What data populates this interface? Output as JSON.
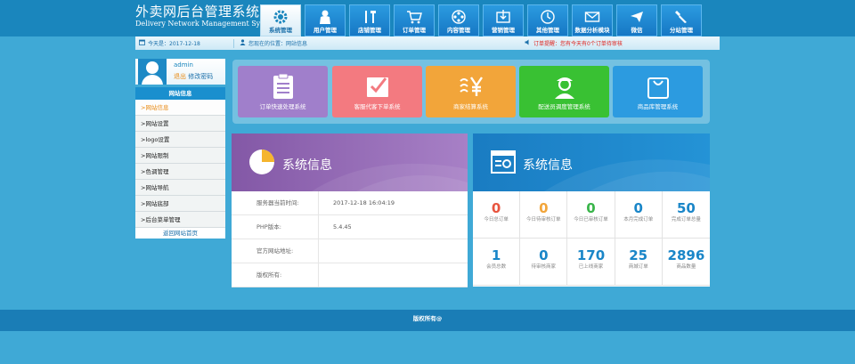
{
  "header": {
    "title_cn": "外卖网后台管理系统",
    "title_en": "Delivery Network Management System"
  },
  "nav": [
    {
      "label": "系统管理",
      "icon": "gear-icon",
      "active": true
    },
    {
      "label": "用户管理",
      "icon": "user-icon",
      "active": false
    },
    {
      "label": "店铺管理",
      "icon": "tools-icon",
      "active": false
    },
    {
      "label": "订单管理",
      "icon": "cart-icon",
      "active": false
    },
    {
      "label": "内容管理",
      "icon": "film-reel-icon",
      "active": false
    },
    {
      "label": "营销管理",
      "icon": "download-box-icon",
      "active": false
    },
    {
      "label": "其他管理",
      "icon": "clock-icon",
      "active": false
    },
    {
      "label": "数据分析模块",
      "icon": "mail-icon",
      "active": false
    },
    {
      "label": "微信",
      "icon": "plane-icon",
      "active": false
    },
    {
      "label": "分站管理",
      "icon": "wrench-icon",
      "active": false
    }
  ],
  "infobar": {
    "date_label": "今天是：2017-12-18",
    "location_prefix": "您现在的位置：",
    "location": "网站信息",
    "reminder_prefix": "订单提醒：",
    "reminder_text": "您有今天有0个订单待审核"
  },
  "user": {
    "name": "admin",
    "logout": "退出",
    "change_password": "修改密码"
  },
  "sidebar": {
    "title": "网站信息",
    "items": [
      ">网站信息",
      ">网站设置",
      ">logo设置",
      ">网站限制",
      ">色调管理",
      ">网站导航",
      ">网站底部",
      ">后台菜单管理"
    ],
    "back": "返回网站首页"
  },
  "tiles": [
    {
      "label": "订单快速处理系统",
      "color": "#a07fcb",
      "icon": "clipboard-list-icon"
    },
    {
      "label": "客服代客下单系统",
      "color": "#f37a80",
      "icon": "checkmark-card-icon"
    },
    {
      "label": "商家结算系统",
      "color": "#f2a53a",
      "icon": "yen-coins-icon"
    },
    {
      "label": "配送员调度管理系统",
      "color": "#39c133",
      "icon": "courier-icon"
    },
    {
      "label": "商品库管理系统",
      "color": "#2c9be0",
      "icon": "shopping-bag-icon"
    }
  ],
  "left_panel": {
    "title": "系统信息",
    "rows": [
      {
        "key": "服务器当前时间:",
        "value": "2017-12-18 16:04:19"
      },
      {
        "key": "PHP版本:",
        "value": "5.4.45"
      },
      {
        "key": "官方网站地址:",
        "value": ""
      },
      {
        "key": "版权所有:",
        "value": ""
      }
    ]
  },
  "right_panel": {
    "title": "系统信息",
    "stats": [
      {
        "num": "0",
        "cap": "今日总订单",
        "color": "#e8543f"
      },
      {
        "num": "0",
        "cap": "今日待审核订单",
        "color": "#f2a53a"
      },
      {
        "num": "0",
        "cap": "今日已审核订单",
        "color": "#39b54a"
      },
      {
        "num": "0",
        "cap": "本月完成订单",
        "color": "#1a86c8"
      },
      {
        "num": "50",
        "cap": "完成订单总量",
        "color": "#1a86c8"
      },
      {
        "num": "1",
        "cap": "会员总数",
        "color": "#1a86c8"
      },
      {
        "num": "0",
        "cap": "待审核商家",
        "color": "#1a86c8"
      },
      {
        "num": "170",
        "cap": "已上线商家",
        "color": "#1a86c8"
      },
      {
        "num": "25",
        "cap": "商城订单",
        "color": "#1a86c8"
      },
      {
        "num": "2896",
        "cap": "商品数量",
        "color": "#1a86c8"
      }
    ]
  },
  "footer": {
    "text": "版权所有@"
  }
}
